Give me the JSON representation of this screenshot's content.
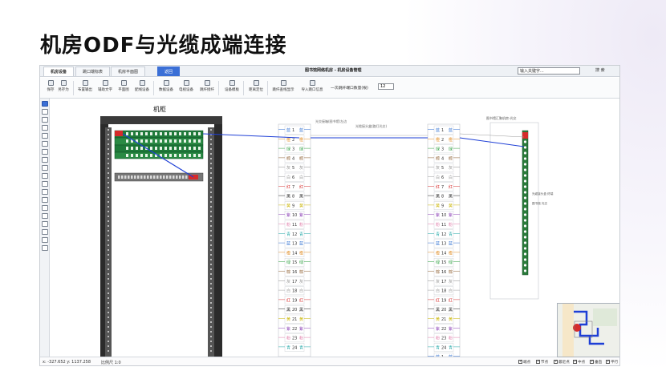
{
  "slide": {
    "title": "机房ODF与光缆成端连接"
  },
  "tabs": [
    {
      "label": "机房设备"
    },
    {
      "label": "跳口端标表"
    },
    {
      "label": "机房平面图"
    },
    {
      "label": "返回"
    }
  ],
  "app_title": "图书馆网络机房 - 机房设备管理",
  "search": {
    "value": "输入关键字...",
    "button": "搜 索"
  },
  "toolbar": {
    "buttons": [
      {
        "label": "保存",
        "icon": "save-icon"
      },
      {
        "label": "另存为",
        "icon": "save-as-icon"
      },
      {
        "label": "布置输出",
        "icon": "layout-icon"
      },
      {
        "label": "辅助文字",
        "icon": "text-icon"
      },
      {
        "label": "平面图",
        "icon": "floorplan-icon"
      },
      {
        "label": "配线设备",
        "icon": "patch-icon"
      },
      {
        "label": "数据设备",
        "icon": "device-icon"
      },
      {
        "label": "电视设备",
        "icon": "tv-icon"
      },
      {
        "label": "跳纤接纤",
        "icon": "fiber-icon"
      },
      {
        "label": "设备模板",
        "icon": "template-icon"
      },
      {
        "label": "距离定位",
        "icon": "locate-icon"
      },
      {
        "label": "跳纤查线显示",
        "icon": "trace-icon"
      },
      {
        "label": "导入跳口信息",
        "icon": "import-icon"
      }
    ],
    "qty_label": "一次跳纤端口数量(根)",
    "qty_value": "12"
  },
  "canvas": {
    "cabinet_label": "机柜",
    "odf_left_caption": "光交接箱(图书馆)左边",
    "odf_right_caption": "图书馆汇聚机房-光交",
    "cable_caption": "光缆接头盒(路灯光交)",
    "splice_caption_1": "光缆接头盒 终端",
    "splice_caption_2": "图书馆 光交"
  },
  "odf_ports": [
    {
      "n": "1",
      "c": "蓝"
    },
    {
      "n": "2",
      "c": "橙"
    },
    {
      "n": "3",
      "c": "绿"
    },
    {
      "n": "4",
      "c": "棕"
    },
    {
      "n": "5",
      "c": "灰"
    },
    {
      "n": "6",
      "c": "白"
    },
    {
      "n": "7",
      "c": "红"
    },
    {
      "n": "8",
      "c": "黑"
    },
    {
      "n": "9",
      "c": "黄"
    },
    {
      "n": "10",
      "c": "紫"
    },
    {
      "n": "11",
      "c": "粉"
    },
    {
      "n": "12",
      "c": "青"
    },
    {
      "n": "13",
      "c": "蓝"
    },
    {
      "n": "14",
      "c": "橙"
    },
    {
      "n": "15",
      "c": "绿"
    },
    {
      "n": "16",
      "c": "棕"
    },
    {
      "n": "17",
      "c": "灰"
    },
    {
      "n": "18",
      "c": "白"
    },
    {
      "n": "19",
      "c": "红"
    },
    {
      "n": "20",
      "c": "黑"
    },
    {
      "n": "21",
      "c": "黄"
    },
    {
      "n": "22",
      "c": "紫"
    },
    {
      "n": "23",
      "c": "粉"
    },
    {
      "n": "24",
      "c": "青"
    }
  ],
  "port_colors": {
    "蓝": "#2f6fd0",
    "橙": "#e08a1e",
    "绿": "#2a9d3c",
    "棕": "#8b5a2b",
    "灰": "#8a8a8a",
    "白": "#9a9a9a",
    "红": "#d62b2b",
    "黑": "#222222",
    "黄": "#c8b400",
    "紫": "#8a3fb5",
    "粉": "#e07aa8",
    "青": "#1fa6a6"
  },
  "statusbar": {
    "coords": "x: -327.652  y: 1137.258",
    "scale": "比例尺 1:0",
    "toggles": [
      {
        "label": "端点"
      },
      {
        "label": "节点"
      },
      {
        "label": "最近点"
      },
      {
        "label": "中点"
      },
      {
        "label": "垂直"
      },
      {
        "label": "平行"
      }
    ]
  }
}
